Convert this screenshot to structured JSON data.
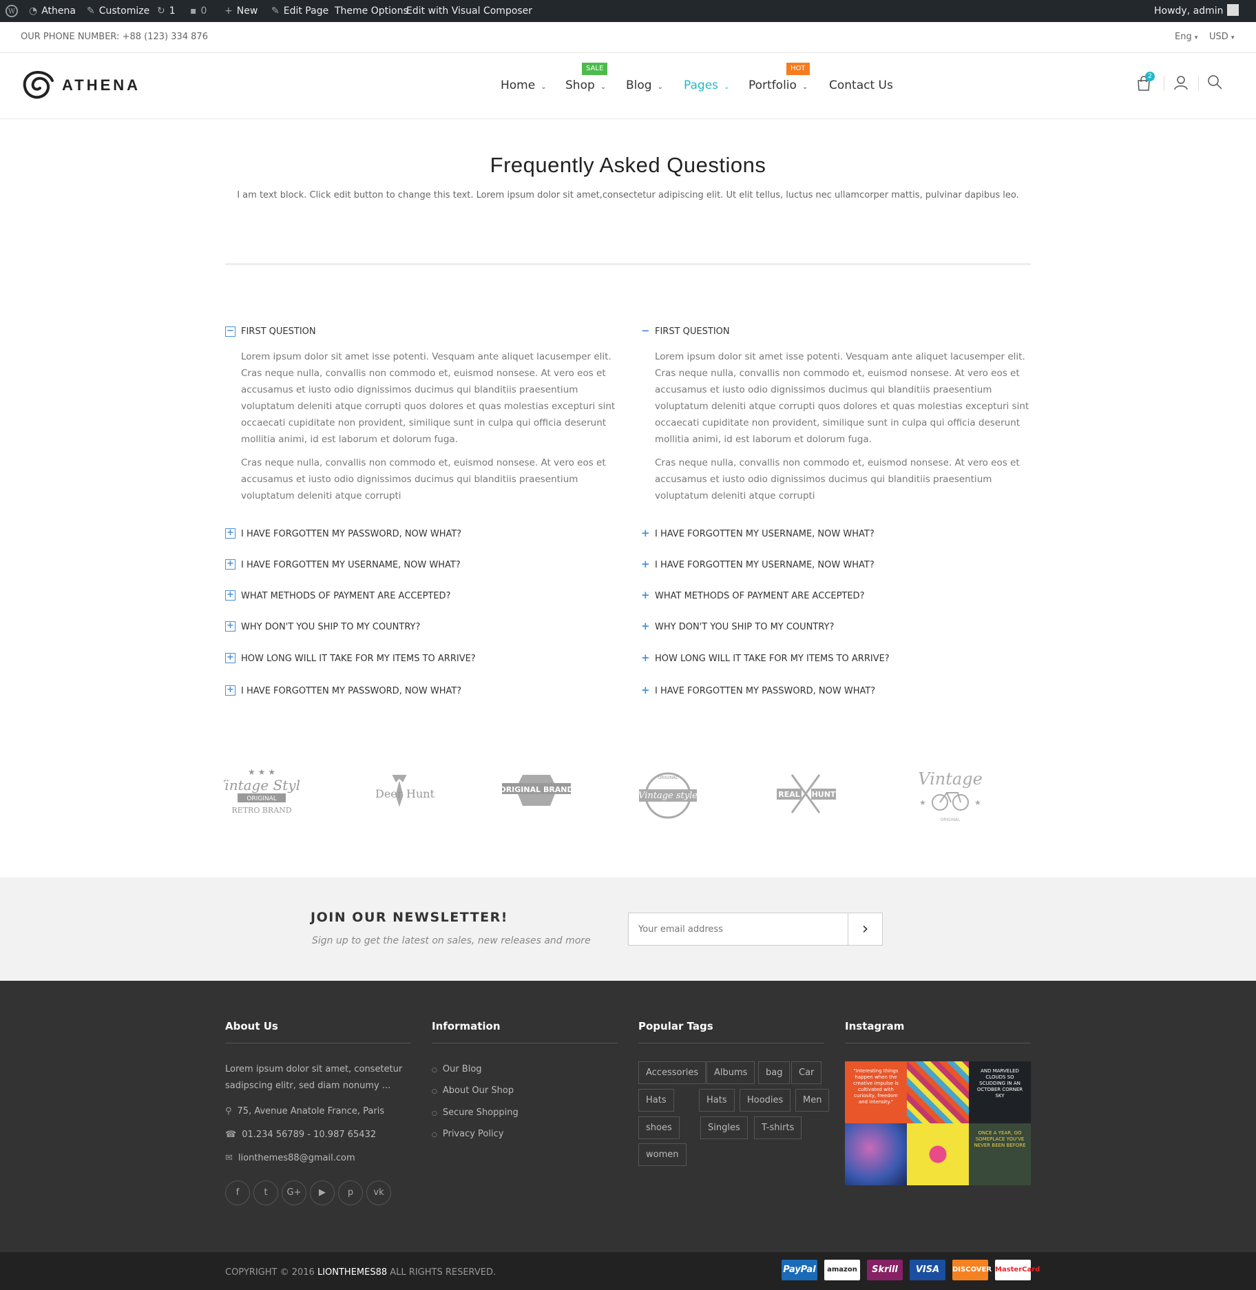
{
  "admin_bar": {
    "site": "Athena",
    "customize": "Customize",
    "updates": "1",
    "comments": "0",
    "new": "New",
    "edit_page": "Edit Page",
    "theme_options": "Theme Options",
    "visual_composer": "Edit with Visual Composer",
    "howdy": "Howdy, admin"
  },
  "topbar": {
    "phone": "OUR PHONE NUMBER: +88 (123) 334 876",
    "language": "Eng",
    "currency": "USD"
  },
  "header": {
    "logo": "ATHENA",
    "nav": [
      {
        "label": "Home",
        "chevron": "⌄"
      },
      {
        "label": "Shop",
        "chevron": "⌄",
        "badge": "SALE"
      },
      {
        "label": "Blog",
        "chevron": "⌄"
      },
      {
        "label": "Pages",
        "chevron": "⌄"
      },
      {
        "label": "Portfolio",
        "chevron": "⌄",
        "badge": "HOT"
      },
      {
        "label": "Contact Us"
      }
    ],
    "cart_count": "2",
    "accent": "#25b8c8",
    "sale_color": "#4cbb4c",
    "hot_color": "#f57c1f"
  },
  "faq": {
    "title": "Frequently Asked Questions",
    "intro": "I am text block. Click edit button to change this text. Lorem ipsum dolor sit amet,consectetur adipiscing elit. Ut elit tellus, luctus nec ullamcorper mattis, pulvinar dapibus leo.",
    "left": {
      "open_question": "FIRST QUESTION",
      "answer_p1": "Lorem ipsum dolor sit amet isse potenti. Vesquam ante aliquet lacusemper elit. Cras neque nulla, convallis non commodo et, euismod nonsese. At vero eos et accusamus et iusto odio dignissimos ducimus qui blanditiis praesentium voluptatum deleniti atque corrupti quos dolores et quas molestias excepturi sint occaecati cupiditate non provident, similique sunt in culpa qui officia deserunt mollitia animi, id est laborum et dolorum fuga.",
      "answer_p2": "Cras neque nulla, convallis non commodo et, euismod nonsese. At vero eos et accusamus et iusto odio dignissimos ducimus qui blanditiis praesentium voluptatum deleniti atque corrupti",
      "questions": [
        "I HAVE FORGOTTEN MY PASSWORD, NOW WHAT?",
        "I HAVE FORGOTTEN MY USERNAME, NOW WHAT?",
        "WHAT METHODS OF PAYMENT ARE ACCEPTED?",
        "WHY DON'T YOU SHIP TO MY COUNTRY?",
        "HOW LONG WILL IT TAKE FOR MY ITEMS TO ARRIVE?",
        "I HAVE FORGOTTEN MY PASSWORD, NOW WHAT?"
      ]
    },
    "right": {
      "open_question": "FIRST QUESTION",
      "answer_p1": "Lorem ipsum dolor sit amet isse potenti. Vesquam ante aliquet lacusemper elit. Cras neque nulla, convallis non commodo et, euismod nonsese. At vero eos et accusamus et iusto odio dignissimos ducimus qui blanditiis praesentium voluptatum deleniti atque corrupti quos dolores et quas molestias excepturi sint occaecati cupiditate non provident, similique sunt in culpa qui officia deserunt mollitia animi, id est laborum et dolorum fuga.",
      "answer_p2": "Cras neque nulla, convallis non commodo et, euismod nonsese. At vero eos et accusamus et iusto odio dignissimos ducimus qui blanditiis praesentium voluptatum deleniti atque corrupti",
      "questions": [
        "I HAVE FORGOTTEN MY USERNAME, NOW WHAT?",
        "I HAVE FORGOTTEN MY USERNAME, NOW WHAT?",
        "WHAT METHODS OF PAYMENT ARE ACCEPTED?",
        "WHY DON'T YOU SHIP TO MY COUNTRY?",
        "HOW LONG WILL IT TAKE FOR MY ITEMS TO ARRIVE?",
        "I HAVE FORGOTTEN MY PASSWORD, NOW WHAT?"
      ]
    }
  },
  "brands": [
    {
      "top": "Vintage Style",
      "mid": "ORIGINAL",
      "bottom": "RETRO BRAND"
    },
    {
      "top": "Deer",
      "mid": "",
      "bottom": "Hunt"
    },
    {
      "top": "ORIGINAL BRAND",
      "mid": "",
      "bottom": ""
    },
    {
      "top": "Vintage style",
      "mid": "ORIGINAL",
      "bottom": ""
    },
    {
      "top": "REAL",
      "mid": "",
      "bottom": "HUNT"
    },
    {
      "top": "Vintage",
      "mid": "",
      "bottom": "ORIGINAL"
    }
  ],
  "newsletter": {
    "title": "JOIN OUR NEWSLETTER!",
    "subtitle": "Sign up to get the latest on sales, new releases and more",
    "placeholder": "Your email address",
    "submit": "›"
  },
  "footer": {
    "about": {
      "title": "About Us",
      "text": "Lorem ipsum dolor sit amet, consetetur sadipscing elitr, sed diam nonumy ...",
      "address": "75, Avenue Anatole France, Paris",
      "phone": "01.234 56789 - 10.987 65432",
      "email": "lionthemes88@gmail.com"
    },
    "information": {
      "title": "Information",
      "links": [
        "Our Blog",
        "About Our Shop",
        "Secure Shopping",
        "Privacy Policy"
      ]
    },
    "tags": {
      "title": "Popular Tags",
      "items": [
        "Accessories",
        "Albums",
        "bag",
        "Car",
        "Hats",
        "Hats",
        "Hoodies",
        "Men",
        "shoes",
        "Singles",
        "T-shirts",
        "women"
      ]
    },
    "instagram": {
      "title": "Instagram",
      "tiles": [
        {
          "color": "#e8562a",
          "text": "\"Interesting things happen when the creative impulse is cultivated with curiosity, freedom and intensity.\""
        },
        {
          "color": "#c03a6b",
          "text": ""
        },
        {
          "color": "#1e2226",
          "text": "AND MARVELED CLOUDS SO SCUDDING IN AN OCTOBER CORNER SKY"
        },
        {
          "color": "#5a4a9a",
          "text": ""
        },
        {
          "color": "#f2e23a",
          "text": ""
        },
        {
          "color": "#3a4a3a",
          "text": "ONCE A YEAR, GO SOMEPLACE YOU'VE NEVER BEEN BEFORE"
        }
      ]
    },
    "social": [
      "f",
      "t",
      "G+",
      "▶",
      "p",
      "vk"
    ]
  },
  "copyright": {
    "prefix": "COPYRIGHT © 2016 ",
    "brand": "LIONTHEMES88",
    "suffix": " ALL RIGHTS RESERVED.",
    "payments": [
      {
        "label": "PayPal",
        "color": "#1a6bb8"
      },
      {
        "label": "amazon",
        "color": "#ffffff"
      },
      {
        "label": "Skrill",
        "color": "#862165"
      },
      {
        "label": "VISA",
        "color": "#1a4fa0"
      },
      {
        "label": "DISCOVER",
        "color": "#f58220"
      },
      {
        "label": "MasterCard",
        "color": "#ffffff"
      }
    ]
  }
}
